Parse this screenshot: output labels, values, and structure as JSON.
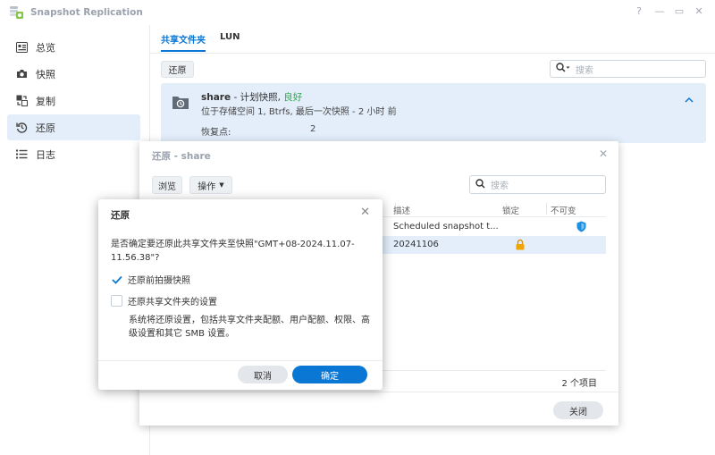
{
  "app": {
    "title": "Snapshot Replication"
  },
  "window_controls": {
    "help": "?",
    "minimize": "—",
    "maximize": "▭",
    "close": "✕"
  },
  "sidebar": {
    "items": [
      {
        "label": "总览",
        "icon": "overview-icon"
      },
      {
        "label": "快照",
        "icon": "camera-icon"
      },
      {
        "label": "复制",
        "icon": "replication-icon"
      },
      {
        "label": "还原",
        "icon": "restore-icon"
      },
      {
        "label": "日志",
        "icon": "log-list-icon"
      }
    ],
    "active_index": 3
  },
  "main": {
    "tabs": [
      {
        "label": "共享文件夹"
      },
      {
        "label": "LUN"
      }
    ],
    "restore_button": "还原",
    "search_placeholder": "搜索",
    "share": {
      "name": "share",
      "dash": " - ",
      "schedule": "计划快照,",
      "status": "良好",
      "location": "位于存储空间 1, Btrfs, 最后一次快照 - 2 小时 前",
      "restore_points_label": "恢复点:",
      "restore_points_value": "2"
    }
  },
  "restore_window": {
    "title": "还原 - share",
    "browse_button": "浏览",
    "action_button": "操作",
    "search_placeholder": "搜索",
    "columns": {
      "description": "描述",
      "locked": "锁定",
      "immutable": "不可变"
    },
    "rows": [
      {
        "description": "Scheduled snapshot t...",
        "locked": false,
        "immutable": true
      },
      {
        "description": "20241106",
        "locked": true,
        "immutable": false
      }
    ],
    "item_count": "2 个项目",
    "close_button": "关闭"
  },
  "confirm_dialog": {
    "title": "还原",
    "message": "是否确定要还原此共享文件夹至快照\"GMT+08-2024.11.07-11.56.38\"?",
    "option1": {
      "label": "还原前拍摄快照",
      "checked": true
    },
    "option2": {
      "label": "还原共享文件夹的设置",
      "checked": false
    },
    "description": "系统将还原设置，包括共享文件夹配额、用户配额、权限、高级设置和其它 SMB 设置。",
    "cancel_button": "取消",
    "ok_button": "确定"
  },
  "colors": {
    "accent": "#0a77d4",
    "selected_bg": "#e3eefa",
    "good_status": "#2fa84f",
    "lock_icon": "#f0a500",
    "shield_icon": "#1a8fe3"
  }
}
